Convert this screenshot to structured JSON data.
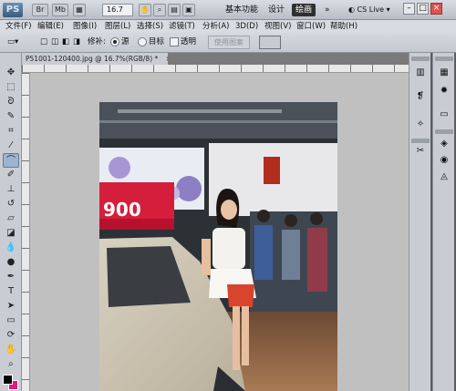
{
  "titlebar": {
    "logo": "PS",
    "icons": [
      "Br",
      "Mb"
    ],
    "zoom": "16.7",
    "workspaces": [
      "基本功能",
      "设计",
      "绘画"
    ],
    "active_workspace": "绘画",
    "more": "»",
    "cs_live": "CS Live ▾",
    "win_buttons": [
      "–",
      "□",
      "×"
    ]
  },
  "menu": [
    "文件(F)",
    "编辑(E)",
    "图像(I)",
    "图层(L)",
    "选择(S)",
    "滤镜(T)",
    "分析(A)",
    "3D(D)",
    "视图(V)",
    "窗口(W)",
    "帮助(H)"
  ],
  "options": {
    "repair_label": "修补:",
    "source_label": "源",
    "target_label": "目标",
    "transparent_label": "透明",
    "use_pattern_label": "使用图案"
  },
  "document": {
    "tab_title": "P51001-120400.jpg @ 16.7%(RGB/8) *",
    "close": "×"
  },
  "colors": {
    "foreground": "#000000",
    "background": "#e3188a"
  }
}
